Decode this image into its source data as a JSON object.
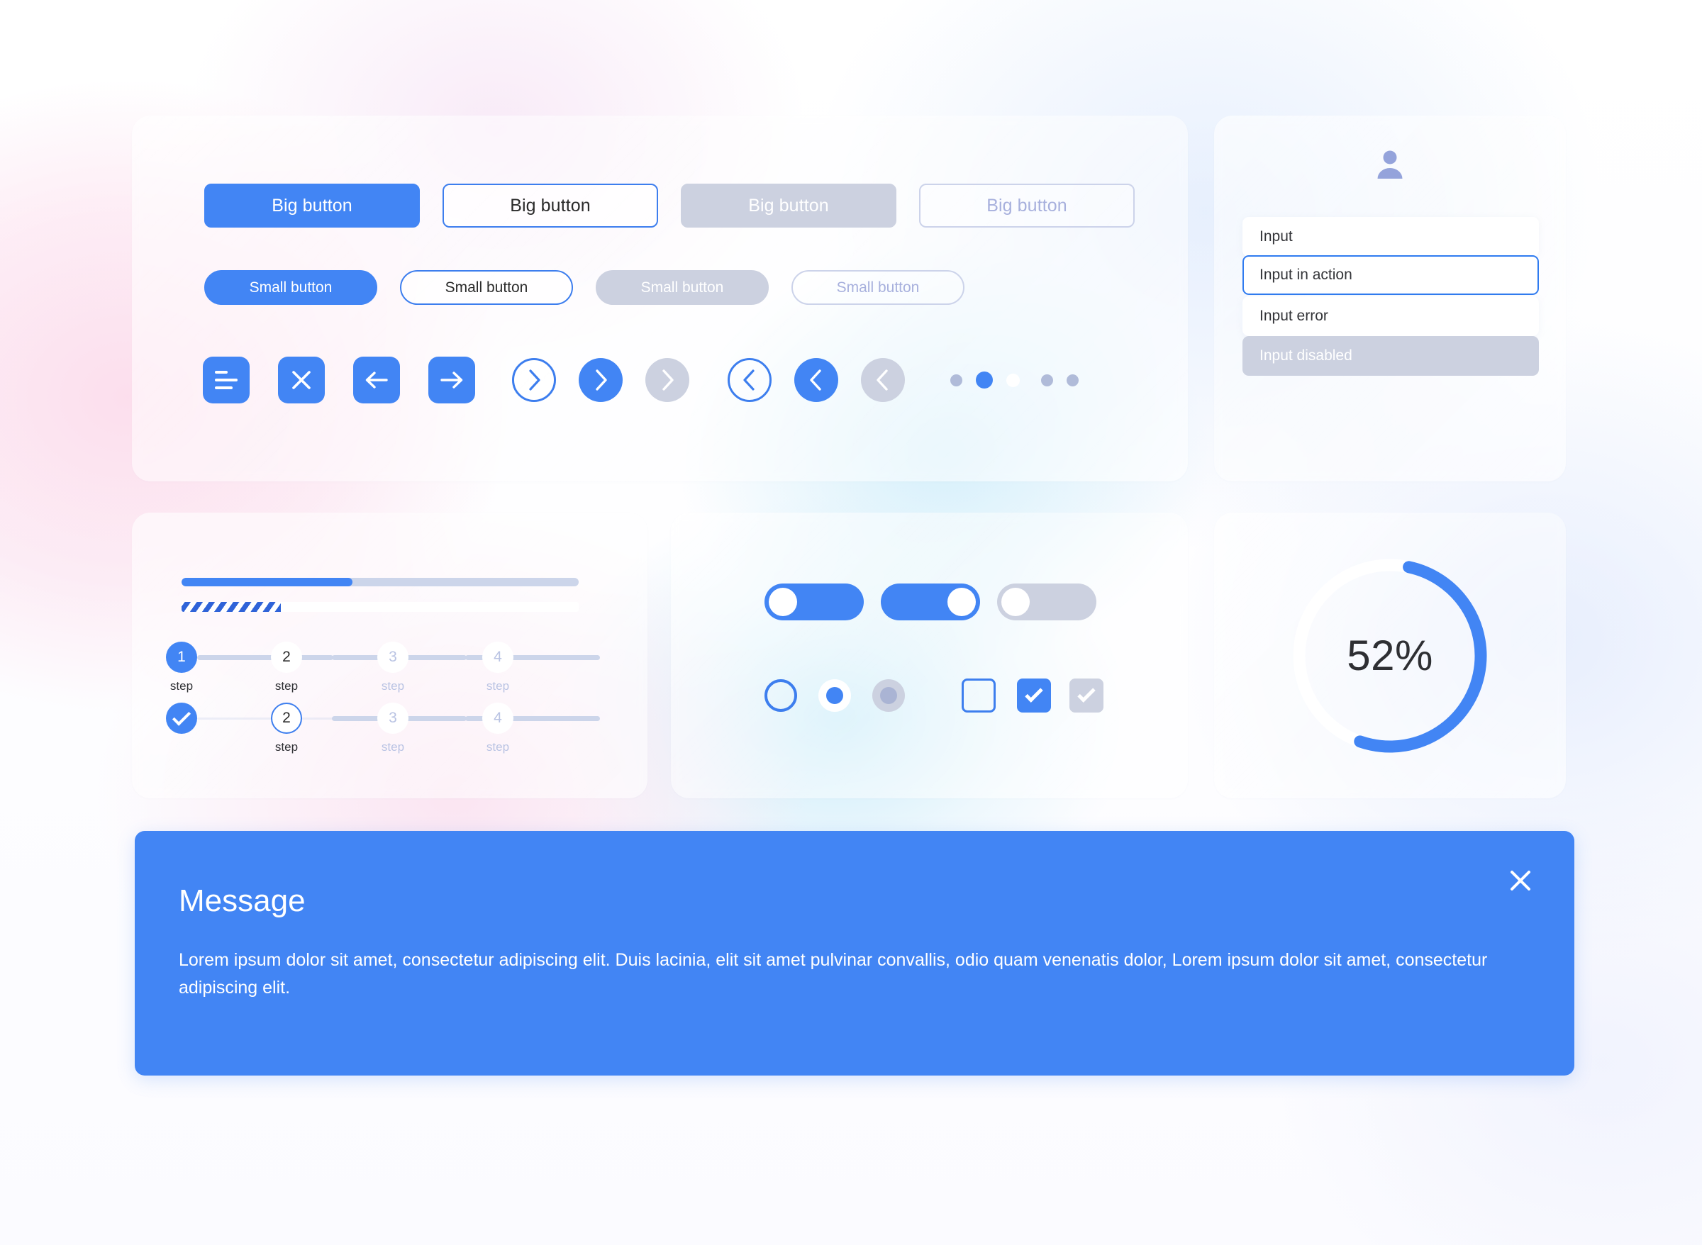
{
  "theme": {
    "accent": "#4285f4",
    "accent_border": "#3d7eee",
    "disabled_fill": "#ccd1e0",
    "disabled_outline_border": "#ccd3ea",
    "disabled_outline_text": "#a7b0dd",
    "track": "#ccd5ea",
    "text_dark": "#2e2f33",
    "text_muted": "#b9c3e3",
    "white": "#ffffff"
  },
  "controls_card": {
    "big_buttons": [
      {
        "label": "Big button",
        "state": "primary"
      },
      {
        "label": "Big button",
        "state": "outline"
      },
      {
        "label": "Big button",
        "state": "disabled-filled"
      },
      {
        "label": "Big button",
        "state": "disabled-outline"
      }
    ],
    "small_buttons": [
      {
        "label": "Small button",
        "state": "primary"
      },
      {
        "label": "Small button",
        "state": "outline"
      },
      {
        "label": "Small button",
        "state": "disabled-filled"
      },
      {
        "label": "Small button",
        "state": "disabled-outline"
      }
    ],
    "square_icon_buttons": [
      {
        "icon": "hamburger-menu-icon"
      },
      {
        "icon": "close-x-icon"
      },
      {
        "icon": "arrow-left-icon"
      },
      {
        "icon": "arrow-right-icon"
      }
    ],
    "chevron_right_group": [
      {
        "icon": "chevron-right-icon",
        "state": "outline"
      },
      {
        "icon": "chevron-right-icon",
        "state": "filled"
      },
      {
        "icon": "chevron-right-icon",
        "state": "disabled"
      }
    ],
    "chevron_left_group": [
      {
        "icon": "chevron-left-icon",
        "state": "outline"
      },
      {
        "icon": "chevron-left-icon",
        "state": "filled"
      },
      {
        "icon": "chevron-left-icon",
        "state": "disabled"
      }
    ],
    "pagination_dots": [
      {
        "state": "gray"
      },
      {
        "state": "active"
      },
      {
        "state": "white"
      },
      {
        "state": "gray"
      },
      {
        "state": "gray"
      }
    ]
  },
  "inputs_card": {
    "avatar_icon": "user-avatar-icon",
    "fields": [
      {
        "value": "Input",
        "state": "default"
      },
      {
        "value": "Input in action",
        "state": "focused"
      },
      {
        "value": "Input error",
        "state": "error"
      },
      {
        "value": "Input disabled",
        "state": "disabled"
      }
    ]
  },
  "progress_card": {
    "bar": {
      "percent": 43,
      "label": "progress-bar"
    },
    "striped_bar": {
      "percent": 25,
      "label": "striped-progress-bar"
    },
    "stepper_top": {
      "steps": [
        {
          "number": "1",
          "label": "step",
          "state": "active"
        },
        {
          "number": "2",
          "label": "step",
          "state": "plain"
        },
        {
          "number": "3",
          "label": "step",
          "state": "todo"
        },
        {
          "number": "4",
          "label": "step",
          "state": "todo"
        }
      ]
    },
    "stepper_bottom": {
      "steps": [
        {
          "number": "",
          "label": "",
          "state": "done"
        },
        {
          "number": "2",
          "label": "step",
          "state": "current"
        },
        {
          "number": "3",
          "label": "step",
          "state": "todo"
        },
        {
          "number": "4",
          "label": "step",
          "state": "todo"
        }
      ]
    }
  },
  "toggles_card": {
    "toggles": [
      {
        "state": "on-left"
      },
      {
        "state": "on-right"
      },
      {
        "state": "disabled"
      }
    ],
    "radios": [
      {
        "state": "empty"
      },
      {
        "state": "selected"
      },
      {
        "state": "disabled"
      }
    ],
    "checkboxes": [
      {
        "state": "empty"
      },
      {
        "state": "checked"
      },
      {
        "state": "disabled"
      }
    ]
  },
  "circular_card": {
    "percent_label": "52%",
    "percent_value": 52
  },
  "message": {
    "title": "Message",
    "body": "Lorem ipsum dolor sit amet, consectetur adipiscing elit. Duis lacinia, elit sit amet pulvinar convallis, odio quam venenatis dolor, Lorem ipsum dolor sit amet, consectetur adipiscing elit.",
    "close_icon": "close-x-icon"
  }
}
